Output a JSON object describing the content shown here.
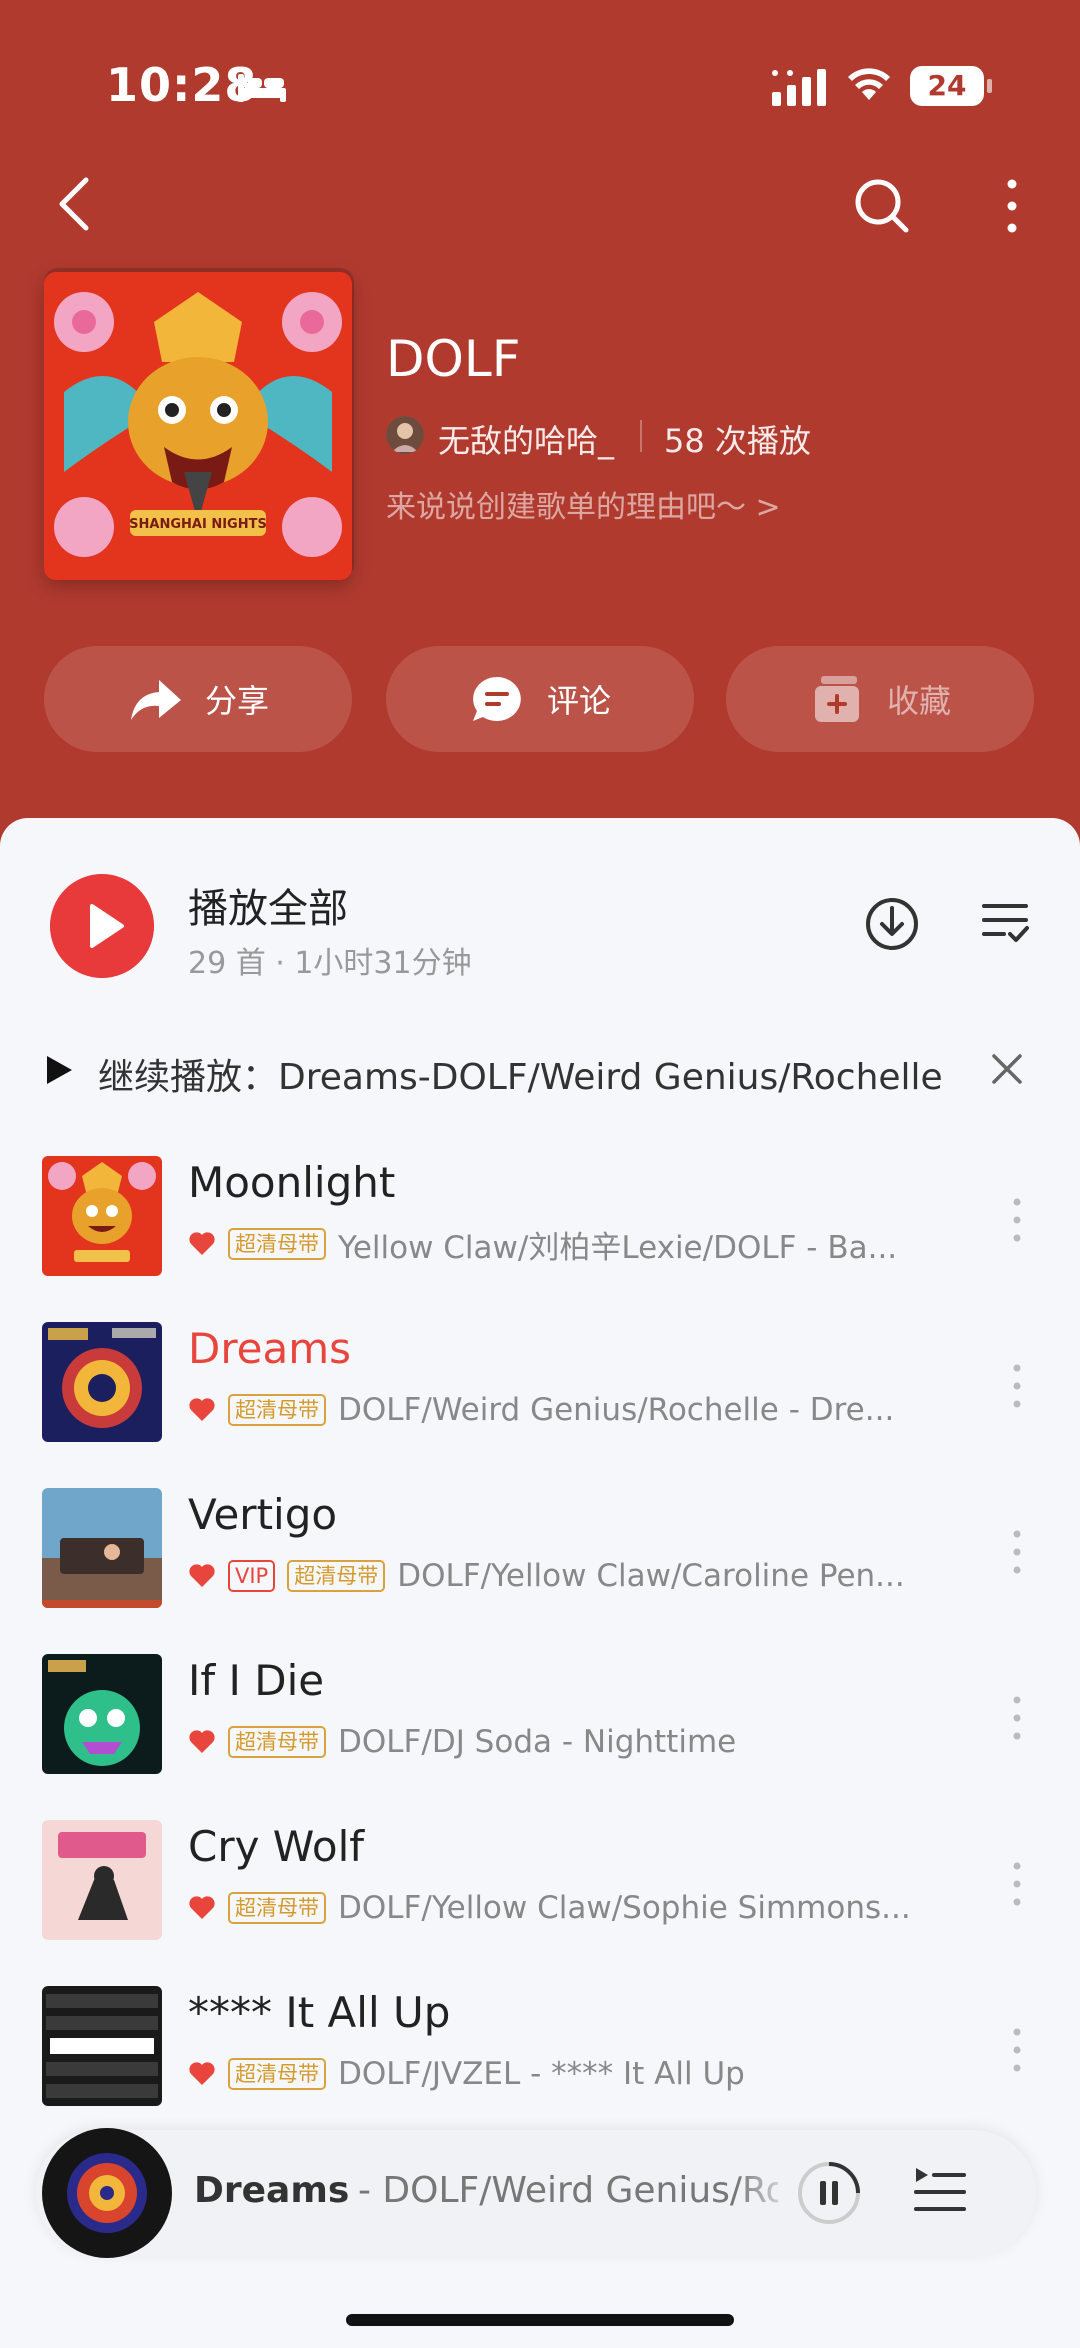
{
  "status": {
    "time": "10:28",
    "battery": "24"
  },
  "colors": {
    "header": "#b13a2f",
    "accent": "#e8453c",
    "hq_tag": "#d9a23e"
  },
  "playlist": {
    "title": "DOLF",
    "creator": "无敌的哈哈_",
    "plays": "58 次播放",
    "description": "来说说创建歌单的理由吧～ >"
  },
  "actions": {
    "share": "分享",
    "comment": "评论",
    "collect": "收藏"
  },
  "play_all": {
    "label": "播放全部",
    "meta": "29 首 · 1小时31分钟"
  },
  "resume": {
    "text": "继续播放：Dreams-DOLF/Weird Genius/Rochelle"
  },
  "songs": [
    {
      "title": "Moonlight",
      "tags": [
        "超清母带"
      ],
      "artist": "Yellow Claw/刘柏辛Lexie/DOLF - Ba...",
      "active": false,
      "icon": "moonlight-cover"
    },
    {
      "title": "Dreams",
      "tags": [
        "超清母带"
      ],
      "artist": "DOLF/Weird Genius/Rochelle - Dre...",
      "active": true,
      "icon": "dreams-cover"
    },
    {
      "title": "Vertigo",
      "tags": [
        "VIP",
        "超清母带"
      ],
      "artist": "DOLF/Yellow Claw/Caroline Pen...",
      "active": false,
      "icon": "vertigo-cover"
    },
    {
      "title": "If I Die",
      "tags": [
        "超清母带"
      ],
      "artist": "DOLF/DJ Soda - Nighttime",
      "active": false,
      "icon": "if-i-die-cover"
    },
    {
      "title": "Cry Wolf",
      "tags": [
        "超清母带"
      ],
      "artist": "DOLF/Yellow Claw/Sophie Simmons...",
      "active": false,
      "icon": "cry-wolf-cover"
    },
    {
      "title": "**** It All Up",
      "tags": [
        "超清母带"
      ],
      "artist": "DOLF/JVZEL - **** It All Up",
      "active": false,
      "icon": "it-all-up-cover"
    }
  ],
  "mini_player": {
    "title": "Dreams",
    "artist": "- DOLF/Weird Genius/Rochelle"
  }
}
